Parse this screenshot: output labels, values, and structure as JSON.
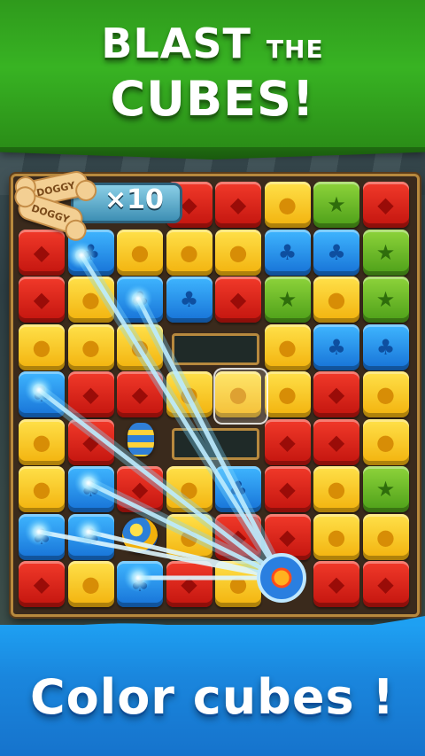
{
  "header": {
    "title_word_1": "BLAST",
    "title_word_2": "THE",
    "title_line_2": "CUBES!"
  },
  "goal": {
    "item_name": "DOGGY",
    "item_name_2": "DOGGY",
    "count": "×10",
    "icon": "bone-icon"
  },
  "board": {
    "columns": 8,
    "rows": 9,
    "colors": {
      "red": "#d9261c",
      "yellow": "#f7c51f",
      "blue": "#2a8fe8",
      "green": "#6cb62a"
    },
    "symbols": {
      "red": "◆",
      "yellow": "●",
      "blue": "♣",
      "green": "★"
    },
    "cubes": [
      [
        "",
        "",
        "",
        "red",
        "red",
        "yellow",
        "green",
        "red"
      ],
      [
        "red",
        "blue",
        "yellow",
        "yellow",
        "yellow",
        "blue",
        "blue",
        "green"
      ],
      [
        "red",
        "yellow",
        "blue",
        "blue",
        "red",
        "green",
        "yellow",
        "green"
      ],
      [
        "yellow",
        "yellow",
        "yellow",
        "",
        "",
        "yellow",
        "blue",
        "blue"
      ],
      [
        "blue",
        "red",
        "red",
        "yellow",
        "yellow",
        "yellow",
        "red",
        "yellow"
      ],
      [
        "yellow",
        "red",
        "",
        "",
        "",
        "red",
        "red",
        "yellow"
      ],
      [
        "yellow",
        "blue",
        "red",
        "yellow",
        "blue",
        "red",
        "yellow",
        "green"
      ],
      [
        "blue",
        "blue",
        "",
        "yellow",
        "red",
        "red",
        "yellow",
        "yellow"
      ],
      [
        "red",
        "yellow",
        "blue",
        "red",
        "yellow",
        "",
        "red",
        "red"
      ]
    ]
  },
  "boosters": {
    "rocket": "rocket-icon",
    "bomb": "color-bomb-icon",
    "source": "color-blast-icon"
  },
  "footer": {
    "tagline": "Color cubes !"
  }
}
